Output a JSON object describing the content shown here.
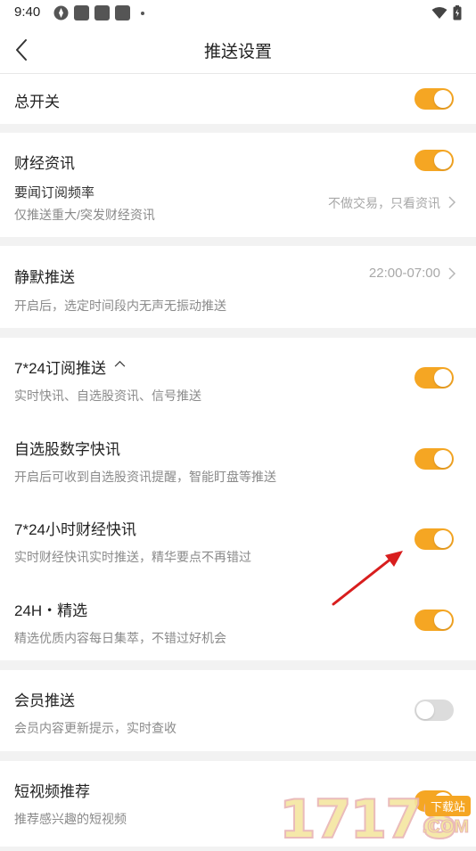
{
  "status_bar": {
    "time": "9:40"
  },
  "header": {
    "title": "推送设置"
  },
  "master": {
    "label": "总开关",
    "enabled": true
  },
  "finance": {
    "label": "财经资讯",
    "enabled": true,
    "frequency_label": "要闻订阅频率",
    "frequency_desc": "仅推送重大/突发财经资讯",
    "frequency_value": "不做交易，只看资讯"
  },
  "silent": {
    "label": "静默推送",
    "time_range": "22:00-07:00",
    "desc": "开启后，选定时间段内无声无振动推送"
  },
  "subscribe_724": {
    "label": "7*24订阅推送",
    "desc": "实时快讯、自选股资讯、信号推送",
    "enabled": true
  },
  "watchlist": {
    "label": "自选股数字快讯",
    "desc": "开启后可收到自选股资讯提醒，智能盯盘等推送",
    "enabled": true
  },
  "news_724": {
    "label": "7*24小时财经快讯",
    "desc": "实时财经快讯实时推送，精华要点不再错过",
    "enabled": true
  },
  "selected_24h": {
    "label": "24H・精选",
    "desc": "精选优质内容每日集萃，不错过好机会",
    "enabled": true
  },
  "member": {
    "label": "会员推送",
    "desc": "会员内容更新提示，实时查收",
    "enabled": false
  },
  "short_video": {
    "label": "短视频推荐",
    "desc": "推荐感兴趣的短视频",
    "enabled": true
  },
  "watermark": {
    "digits": "17178",
    "badge": "下载站",
    "domain": ".COM"
  },
  "colors": {
    "accent": "#f5a623",
    "toggle_off": "#dcdcdc",
    "annotation_arrow": "#d81e1e"
  }
}
